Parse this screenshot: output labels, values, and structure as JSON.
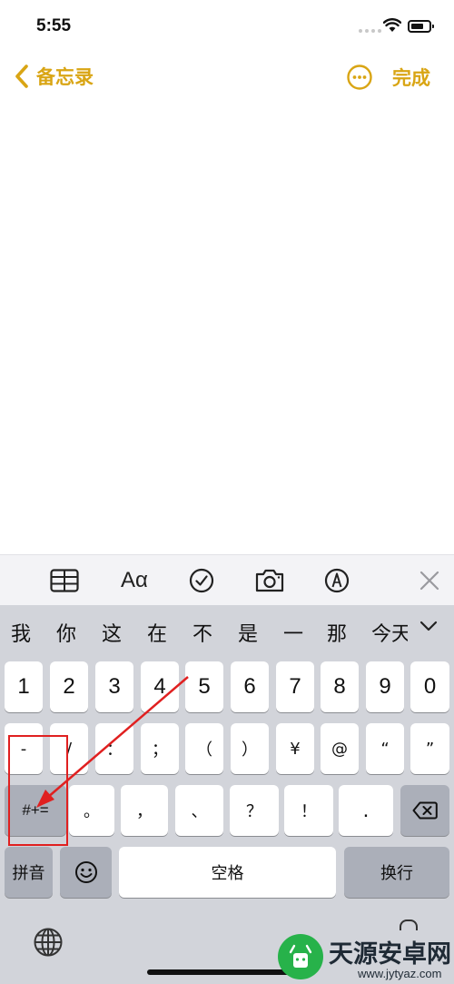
{
  "status_bar": {
    "time": "5:55"
  },
  "nav": {
    "back_label": "备忘录",
    "done_label": "完成"
  },
  "toolbar": {
    "text_style_label": "Aα"
  },
  "keyboard": {
    "candidates": [
      "我",
      "你",
      "这",
      "在",
      "不",
      "是",
      "一",
      "那",
      "今天"
    ],
    "row1": [
      "1",
      "2",
      "3",
      "4",
      "5",
      "6",
      "7",
      "8",
      "9",
      "0"
    ],
    "row2": [
      "-",
      "/",
      "：",
      "；",
      "（",
      "）",
      "¥",
      "@",
      "“",
      "”"
    ],
    "row3_left": "#+=",
    "row3": [
      "。",
      "，",
      "、",
      "？",
      "！",
      "."
    ],
    "pinyin_label": "拼音",
    "space_label": "空格",
    "return_label": "换行"
  },
  "watermark": {
    "name": "天源安卓网",
    "url": "www.jytyaz.com"
  },
  "colors": {
    "accent": "#d9a514",
    "annotation": "#e02020"
  }
}
